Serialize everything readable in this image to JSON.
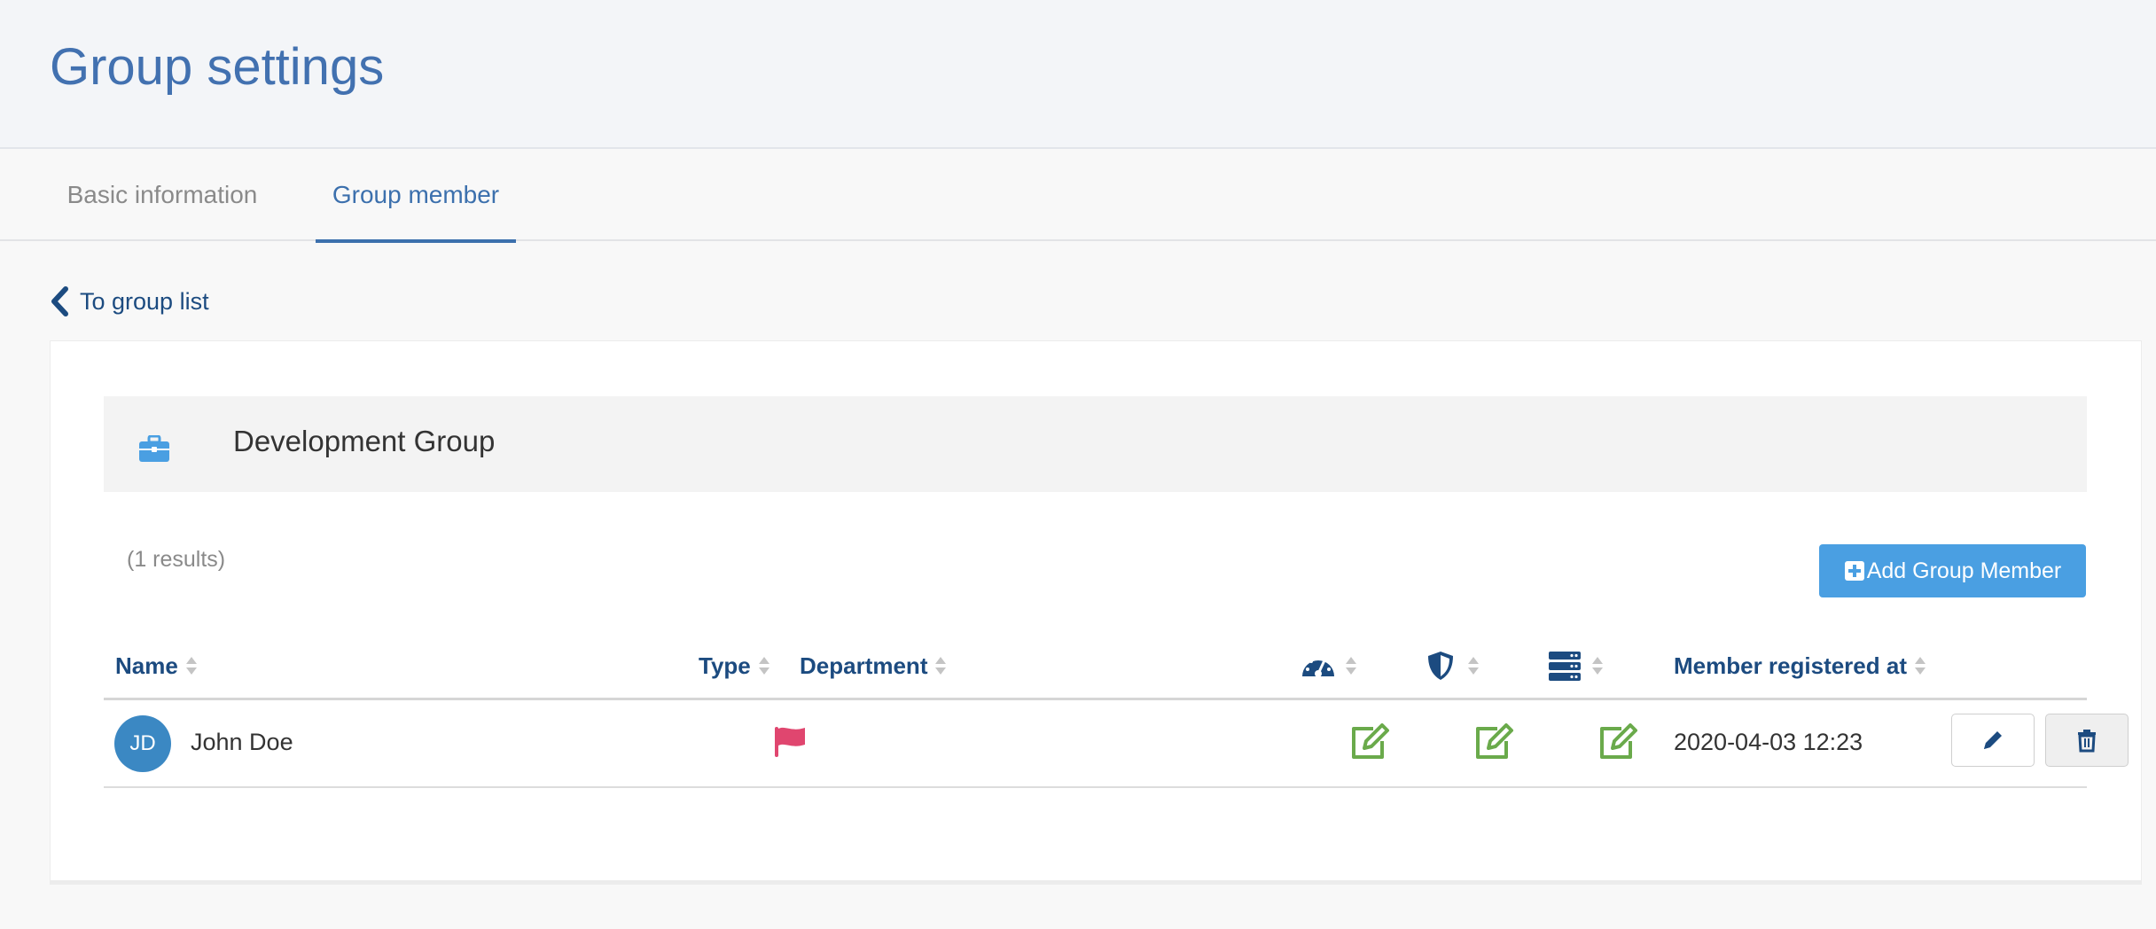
{
  "page": {
    "title": "Group settings"
  },
  "tabs": [
    {
      "label": "Basic information",
      "active": false
    },
    {
      "label": "Group member",
      "active": true
    }
  ],
  "back_link": {
    "label": "To group list",
    "icon": "chevron-left-icon"
  },
  "group": {
    "name": "Development Group",
    "icon": "briefcase-icon"
  },
  "results": {
    "text": "(1 results)"
  },
  "add_button": {
    "label": "Add Group Member",
    "icon": "plus-square-icon"
  },
  "table": {
    "columns": [
      {
        "label": "Name",
        "sortable": true
      },
      {
        "label": "Type",
        "sortable": true
      },
      {
        "label": "Department",
        "sortable": true
      },
      {
        "icon": "dashboard-icon",
        "sortable": true
      },
      {
        "icon": "shield-icon",
        "sortable": true
      },
      {
        "icon": "server-icon",
        "sortable": true
      },
      {
        "label": "Member registered at",
        "sortable": true
      }
    ],
    "rows": [
      {
        "initials": "JD",
        "name": "John Doe",
        "type_icon": "flag-icon",
        "department": "",
        "permissions": [
          "edit-icon",
          "edit-icon",
          "edit-icon"
        ],
        "registered_at": "2020-04-03 12:23",
        "actions": [
          "pencil-icon",
          "trash-icon"
        ]
      }
    ]
  },
  "colors": {
    "title": "#4271b0",
    "accent": "#3c70ad",
    "header_text": "#1c4b80",
    "primary_button": "#4a9fe2",
    "avatar": "#3b88c3",
    "flag": "#e0466f",
    "edit_icon": "#6aaa4b"
  }
}
